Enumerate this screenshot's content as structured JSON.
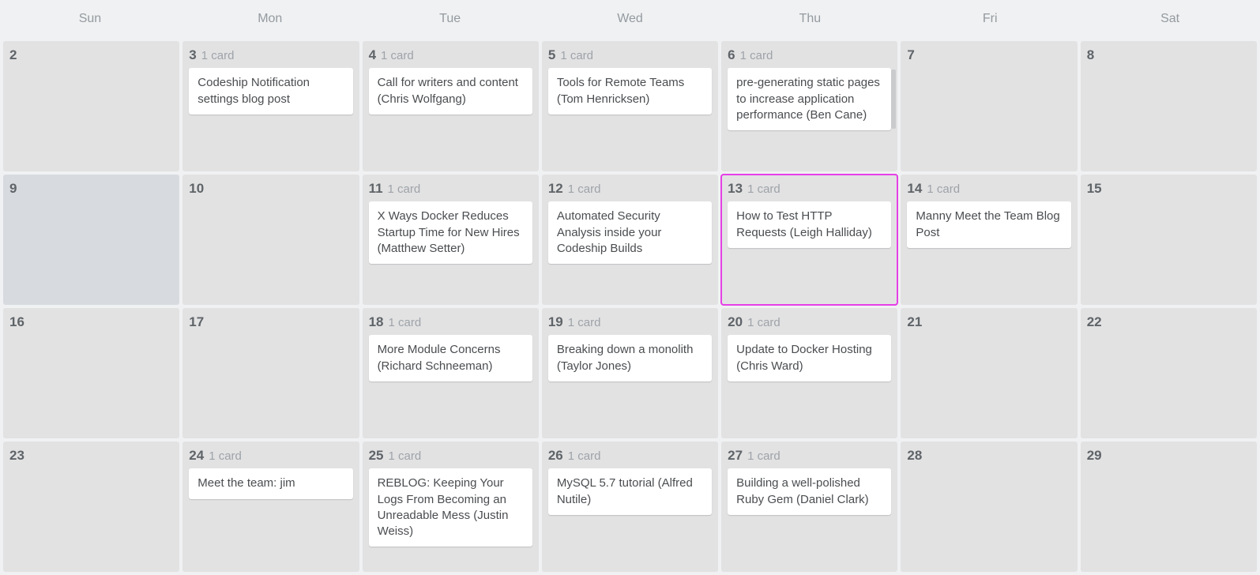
{
  "weekdays": [
    "Sun",
    "Mon",
    "Tue",
    "Wed",
    "Thu",
    "Fri",
    "Sat"
  ],
  "card_count_label": "1 card",
  "weeks": [
    [
      {
        "num": "2",
        "cards": []
      },
      {
        "num": "3",
        "count": "1 card",
        "cards": [
          {
            "title": "Codeship Notification settings blog post"
          }
        ]
      },
      {
        "num": "4",
        "count": "1 card",
        "cards": [
          {
            "title": "Call for writers and content (Chris Wolfgang)"
          }
        ]
      },
      {
        "num": "5",
        "count": "1 card",
        "cards": [
          {
            "title": "Tools for Remote Teams (Tom Henricksen)"
          }
        ]
      },
      {
        "num": "6",
        "count": "1 card",
        "cards": [
          {
            "title": "pre-generating static pages to increase application performance (Ben Cane)",
            "status": "done"
          }
        ]
      },
      {
        "num": "7",
        "cards": []
      },
      {
        "num": "8",
        "cards": []
      }
    ],
    [
      {
        "num": "9",
        "cards": [],
        "highlight": true
      },
      {
        "num": "10",
        "cards": []
      },
      {
        "num": "11",
        "count": "1 card",
        "cards": [
          {
            "title": "X Ways Docker Reduces Startup Time for New Hires (Matthew Setter)"
          }
        ]
      },
      {
        "num": "12",
        "count": "1 card",
        "cards": [
          {
            "title": "Automated Security Analysis inside your Codeship Builds"
          }
        ]
      },
      {
        "num": "13",
        "count": "1 card",
        "selected": true,
        "cards": [
          {
            "title": "How to Test HTTP Requests (Leigh Halliday)"
          }
        ]
      },
      {
        "num": "14",
        "count": "1 card",
        "cards": [
          {
            "title": "Manny Meet the Team Blog Post"
          }
        ]
      },
      {
        "num": "15",
        "cards": []
      }
    ],
    [
      {
        "num": "16",
        "cards": []
      },
      {
        "num": "17",
        "cards": []
      },
      {
        "num": "18",
        "count": "1 card",
        "cards": [
          {
            "title": "More Module Concerns (Richard Schneeman)"
          }
        ]
      },
      {
        "num": "19",
        "count": "1 card",
        "cards": [
          {
            "title": "Breaking down a monolith (Taylor Jones)"
          }
        ]
      },
      {
        "num": "20",
        "count": "1 card",
        "cards": [
          {
            "title": "Update to Docker Hosting (Chris Ward)"
          }
        ]
      },
      {
        "num": "21",
        "cards": []
      },
      {
        "num": "22",
        "cards": []
      }
    ],
    [
      {
        "num": "23",
        "cards": []
      },
      {
        "num": "24",
        "count": "1 card",
        "cards": [
          {
            "title": "Meet the team: jim"
          }
        ]
      },
      {
        "num": "25",
        "count": "1 card",
        "cards": [
          {
            "title": "REBLOG: Keeping Your Logs From Becoming an Unreadable Mess (Justin Weiss)"
          }
        ]
      },
      {
        "num": "26",
        "count": "1 card",
        "cards": [
          {
            "title": "MySQL 5.7 tutorial (Alfred Nutile)"
          }
        ]
      },
      {
        "num": "27",
        "count": "1 card",
        "cards": [
          {
            "title": "Building a well-polished Ruby Gem (Daniel Clark)"
          }
        ]
      },
      {
        "num": "28",
        "cards": []
      },
      {
        "num": "29",
        "cards": []
      }
    ]
  ]
}
